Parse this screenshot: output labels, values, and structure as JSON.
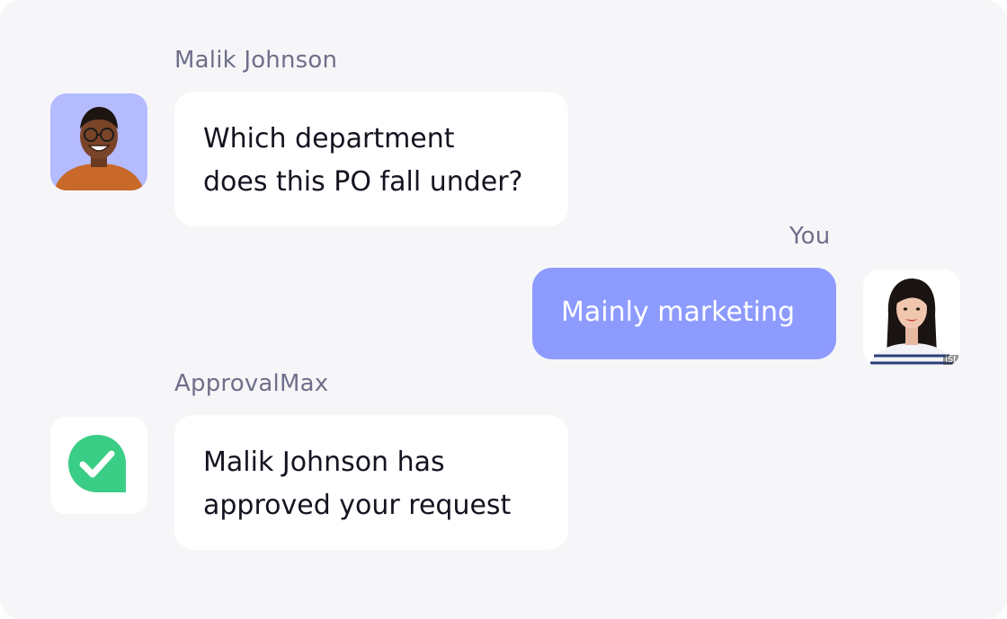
{
  "messages": [
    {
      "sender": "Malik Johnson",
      "lines": [
        "Which department",
        "does this PO fall under?"
      ],
      "avatar": "man-portrait-avatar",
      "side": "left"
    },
    {
      "sender": "You",
      "lines": [
        "Mainly marketing"
      ],
      "avatar": "woman-portrait-avatar",
      "avatar_watermark": "iSt",
      "side": "right"
    },
    {
      "sender": "ApprovalMax",
      "lines": [
        "Malik Johnson has",
        "approved your request"
      ],
      "avatar": "checkmark-icon",
      "side": "left"
    }
  ],
  "colors": {
    "background": "#f6f6f9",
    "bubble_incoming": "#ffffff",
    "bubble_outgoing": "#8d9bff",
    "sender_text": "#6f6f8a",
    "approval_green": "#3acd85",
    "malik_avatar_bg": "#b4bbff"
  }
}
